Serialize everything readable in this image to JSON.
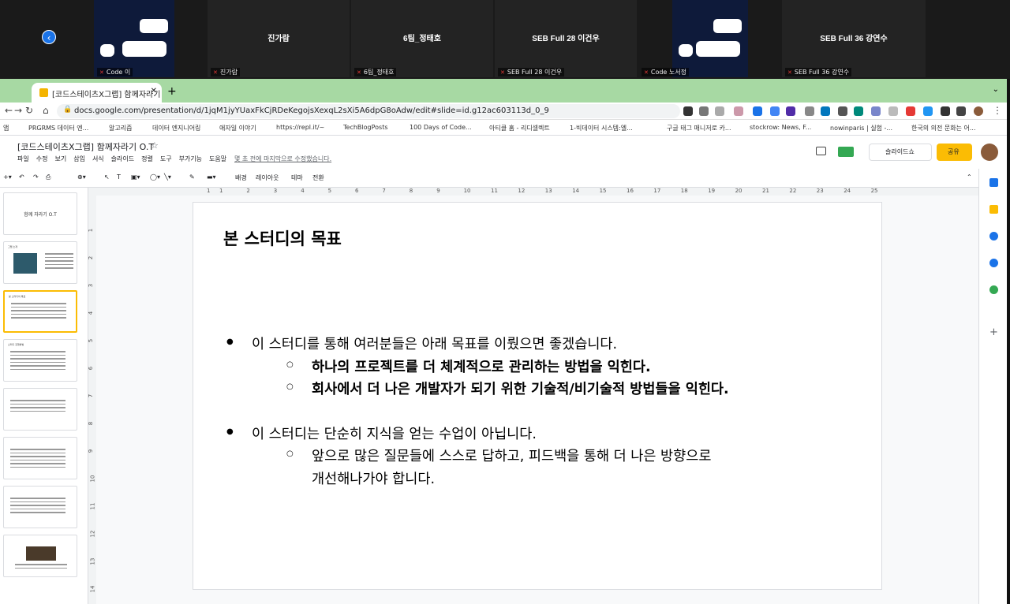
{
  "zoom": {
    "participants": [
      {
        "name": "",
        "label": "Code 이",
        "type": "avatar"
      },
      {
        "name": "진가람",
        "label": "진가람",
        "type": "name"
      },
      {
        "name": "6팀_정태호",
        "label": "6팀_정태호",
        "type": "name"
      },
      {
        "name": "SEB Full 28 이건우",
        "label": "SEB Full 28 이건우",
        "type": "name"
      },
      {
        "name": "",
        "label": "Code 노서정",
        "type": "avatar"
      },
      {
        "name": "SEB Full 36 강연수",
        "label": "SEB Full 36 강연수",
        "type": "name"
      }
    ],
    "back_icon": "chevron-left-icon"
  },
  "browser": {
    "tab_title": "[코드스테이츠X그랩] 함께자라기 O.",
    "url": "docs.google.com/presentation/d/1jqM1jyYUaxFkCjRDeKegojsXexqL2sXi5A6dpG8oAdw/edit#slide=id.g12ac603113d_0_9",
    "bookmarks": [
      "앱",
      "PRGRMS 데이터 엔...",
      "알고리즘",
      "데이터 엔지니어링",
      "애자일 이야기",
      "https://repl.it/~",
      "TechBlogPosts",
      "100 Days of Code...",
      "아티클 홈 - 리디셀렉트",
      "1-빅데이터 시스템:엘...",
      "구글 태그 매니저로 카...",
      "stockrow: News, F...",
      "nowinparis | 실험 -...",
      "한국의 의전 문화는 어..."
    ]
  },
  "doc": {
    "title": "[코드스테이츠X그랩] 함께자라기 O.T",
    "menus": [
      "파일",
      "수정",
      "보기",
      "삽입",
      "서식",
      "슬라이드",
      "정렬",
      "도구",
      "부가기능",
      "도움말"
    ],
    "saved_status": "몇 초 전에 마지막으로 수정했습니다.",
    "slideshow_label": "슬라이드쇼",
    "share_label": "공유",
    "toolbar": {
      "bg": "배경",
      "layout": "레이아웃",
      "theme": "테마",
      "transition": "전환"
    }
  },
  "thumbs": [
    {
      "title": "",
      "center": "함께 자라기 O.T"
    },
    {
      "title": "그랩 소개",
      "center": ""
    },
    {
      "title": "본 스터디의 목표",
      "center": ""
    },
    {
      "title": "스터디 진행방법",
      "center": ""
    },
    {
      "title": "",
      "center": ""
    },
    {
      "title": "",
      "center": ""
    },
    {
      "title": "",
      "center": ""
    },
    {
      "title": "",
      "center": ""
    }
  ],
  "ruler": [
    "1",
    "1",
    "2",
    "3",
    "4",
    "5",
    "6",
    "7",
    "8",
    "9",
    "10",
    "11",
    "12",
    "13",
    "14",
    "15",
    "16",
    "17",
    "18",
    "19",
    "20",
    "21",
    "22",
    "23",
    "24",
    "25"
  ],
  "vruler": [
    "1",
    "2",
    "3",
    "4",
    "5",
    "6",
    "7",
    "8",
    "9",
    "10",
    "11",
    "12",
    "13",
    "14"
  ],
  "slide": {
    "title": "본 스터디의 목표",
    "bullets": [
      {
        "text": "이 스터디를 통해 여러분들은 아래 목표를 이뤘으면 좋겠습니다.",
        "subs": [
          {
            "text": "하나의 프로젝트를 더 체계적으로 관리하는 방법을 익힌다.",
            "bold": true
          },
          {
            "text": "회사에서 더 나은 개발자가 되기 위한 기술적/비기술적 방법들을 익힌다.",
            "bold": true
          }
        ]
      },
      {
        "text": "이 스터디는 단순히 지식을 얻는 수업이 아닙니다.",
        "subs": [
          {
            "text": "앞으로 많은 질문들에 스스로 답하고, 피드백을 통해 더 나은 방향으로",
            "bold": false
          },
          {
            "text": "개선해나가야 합니다.",
            "bold": false
          }
        ]
      }
    ]
  }
}
